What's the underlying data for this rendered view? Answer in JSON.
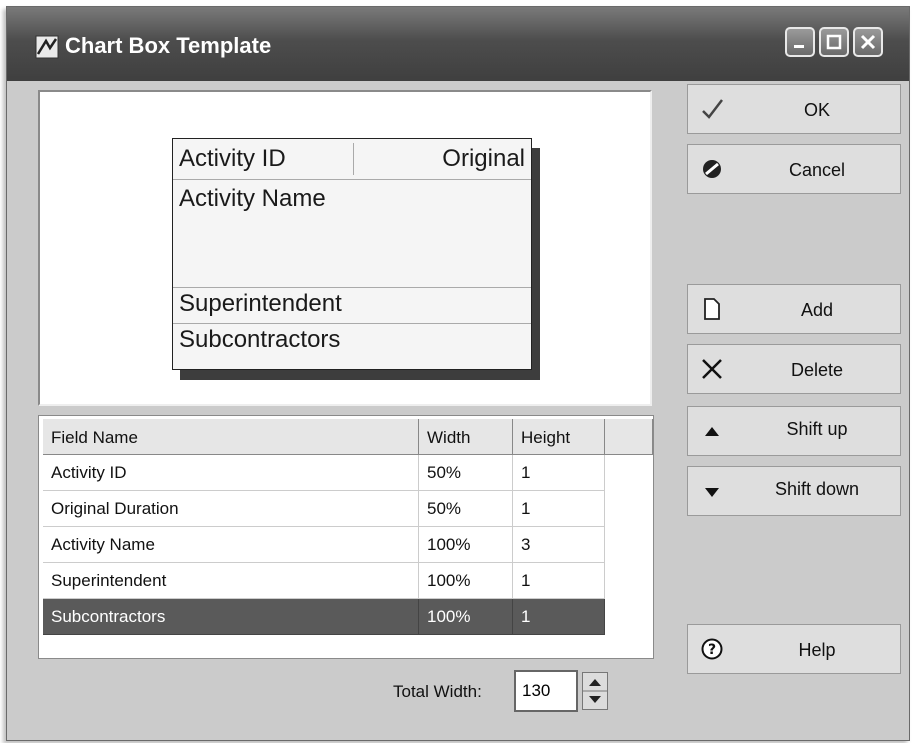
{
  "window": {
    "title": "Chart Box Template"
  },
  "preview": {
    "activity_id": "Activity ID",
    "original": "Original",
    "activity_name": "Activity Name",
    "superintendent": "Superintendent",
    "subcontractors": "Subcontractors"
  },
  "grid": {
    "headers": {
      "field": "Field Name",
      "width": "Width",
      "height": "Height"
    },
    "rows": [
      {
        "field": "Activity ID",
        "width": "50%",
        "height": "1"
      },
      {
        "field": "Original Duration",
        "width": "50%",
        "height": "1"
      },
      {
        "field": "Activity Name",
        "width": "100%",
        "height": "3"
      },
      {
        "field": "Superintendent",
        "width": "100%",
        "height": "1"
      },
      {
        "field": "Subcontractors",
        "width": "100%",
        "height": "1"
      }
    ]
  },
  "total_width": {
    "label": "Total Width:",
    "value": "130"
  },
  "buttons": {
    "ok": "OK",
    "cancel": "Cancel",
    "add": "Add",
    "delete": "Delete",
    "shift_up": "Shift up",
    "shift_down": "Shift down",
    "help": "Help"
  },
  "icons": {
    "ok": "checkmark-icon",
    "cancel": "no-entry-icon",
    "add": "new-document-icon",
    "delete": "x-icon",
    "shift_up": "triangle-up-icon",
    "shift_down": "triangle-down-icon",
    "help": "question-circle-icon"
  }
}
